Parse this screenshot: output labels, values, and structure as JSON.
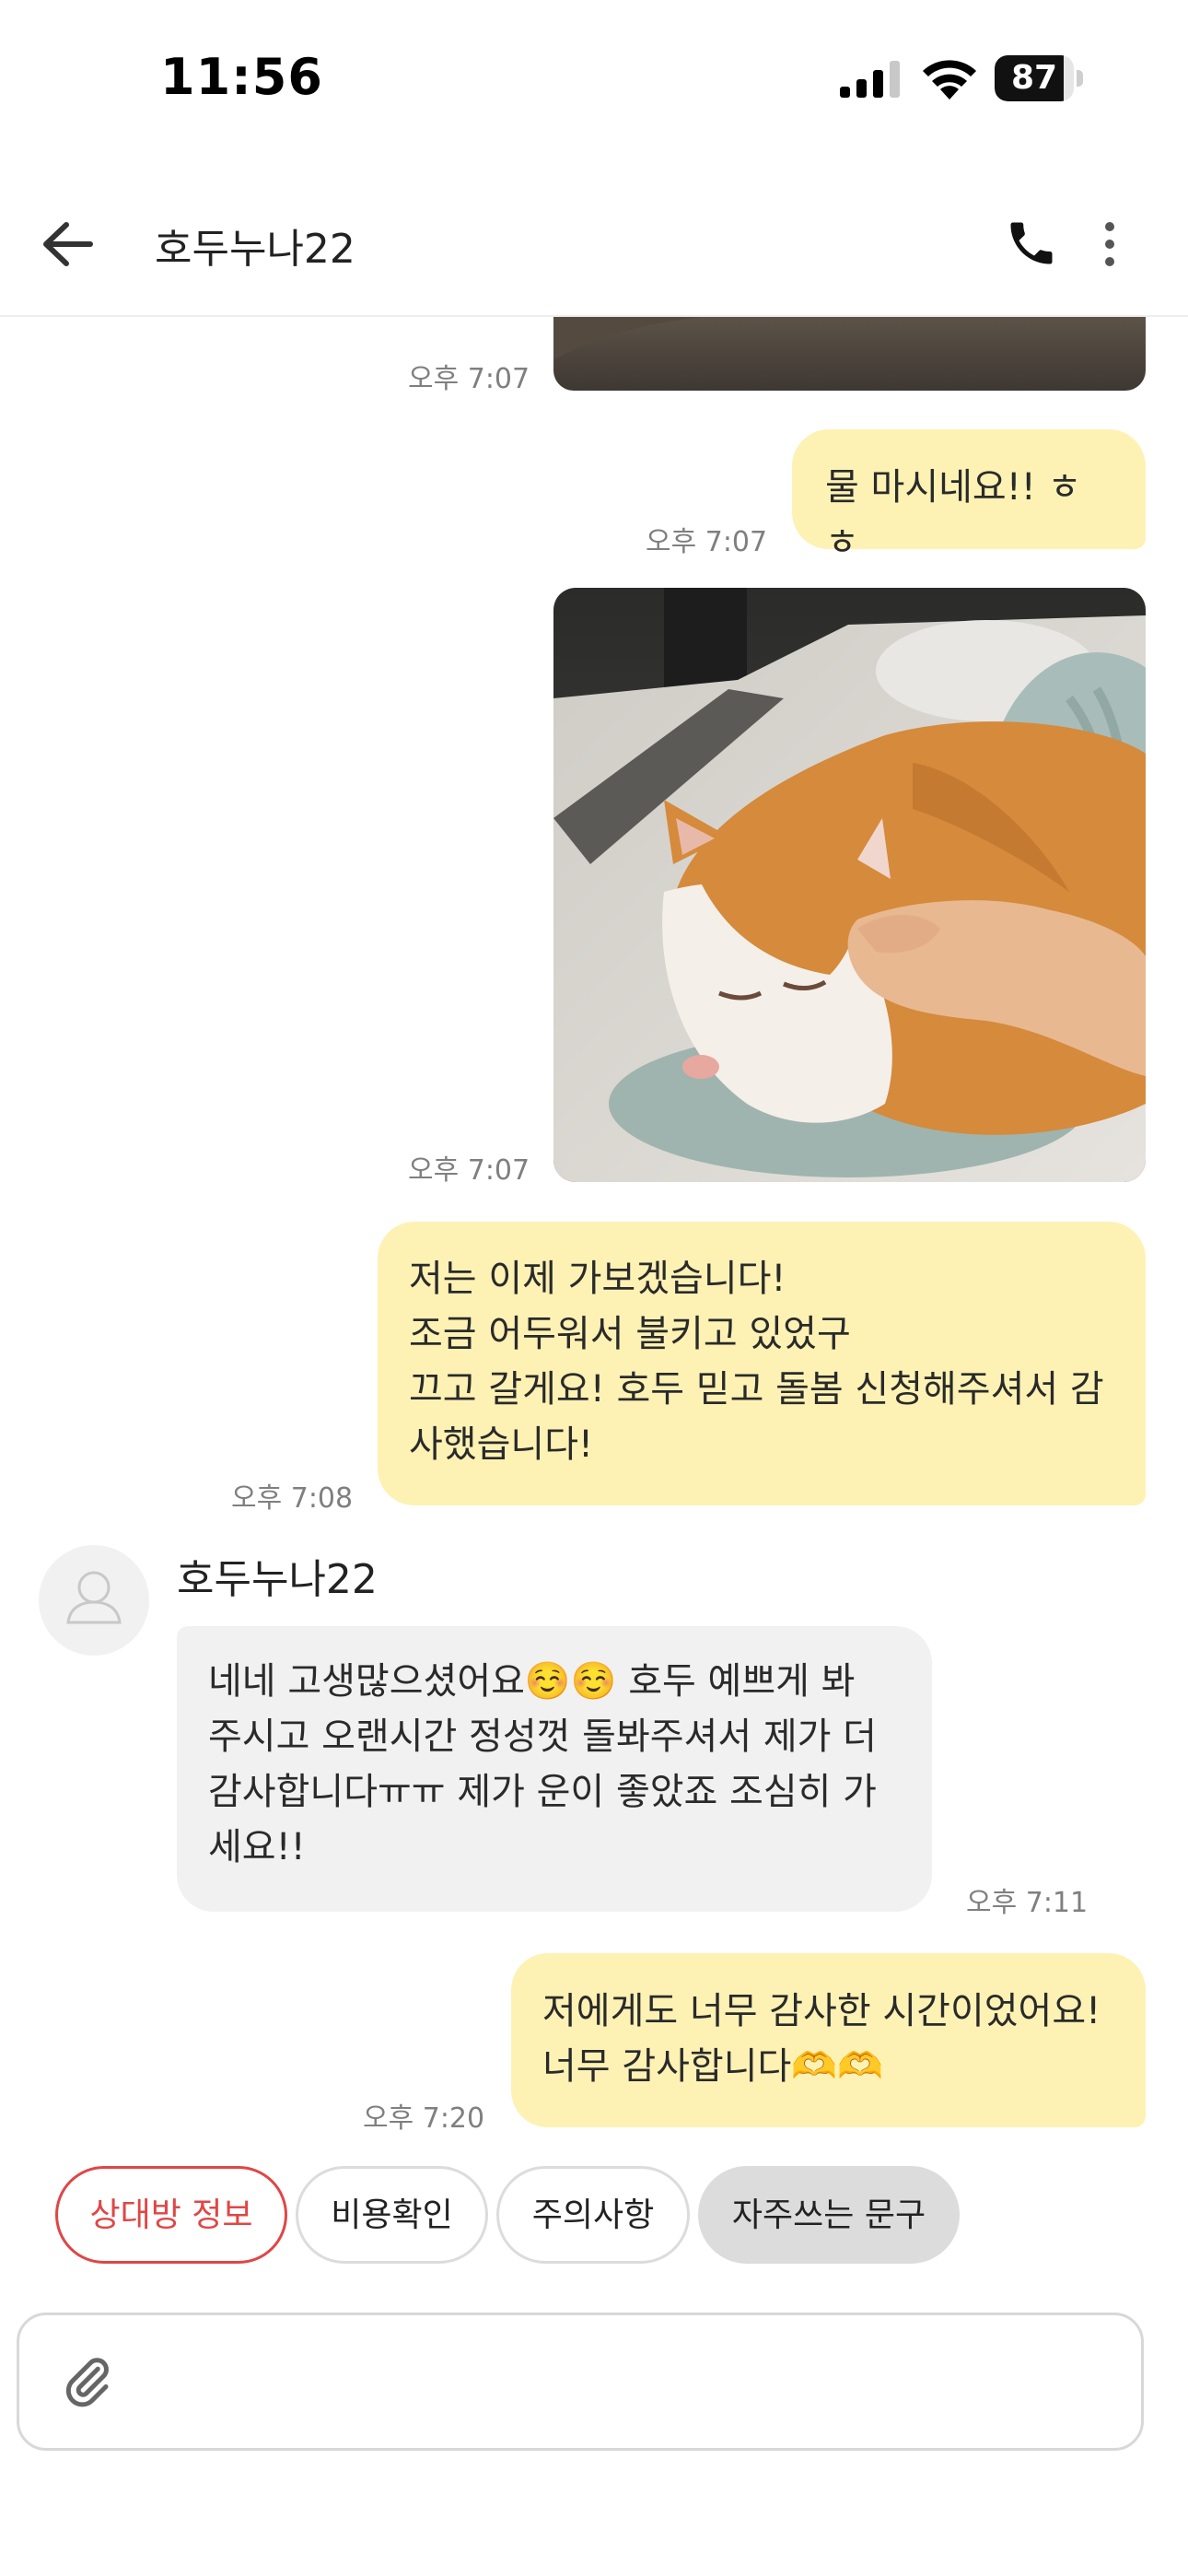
{
  "status_bar": {
    "time": "11:56",
    "battery_level": "87",
    "battery_fraction": 0.87
  },
  "header": {
    "title": "호두누나22",
    "back_icon": "arrow-left-icon",
    "phone_icon": "phone-icon",
    "more_icon": "more-vertical-icon"
  },
  "messages": [
    {
      "type": "image",
      "from": "me",
      "time": "오후 7:07"
    },
    {
      "type": "text",
      "from": "me",
      "text": "물 마시네요!! ㅎㅎ",
      "time": "오후 7:07"
    },
    {
      "type": "image",
      "from": "me",
      "time": "오후 7:07"
    },
    {
      "type": "text",
      "from": "me",
      "text": "저는 이제 가보겠습니다!\n조금 어두워서 불키고 있었구\n끄고 갈게요! 호두 믿고 돌봄 신청해주셔서 감\n사했습니다!",
      "time": "오후 7:08"
    },
    {
      "type": "text",
      "from": "them",
      "sender": "호두누나22",
      "text": "네네 고생많으셨어요☺️☺️ 호두 예쁘게 봐\n주시고 오랜시간 정성껏 돌봐주셔서 제가 더\n감사합니다ㅠㅠ 제가 운이 좋았죠  조심히 가\n세요!!",
      "time": "오후 7:11"
    },
    {
      "type": "text",
      "from": "me",
      "text": "저에게도 너무 감사한 시간이었어요!\n너무 감사합니다🫶🫶",
      "time": "오후 7:20"
    }
  ],
  "quick_actions": [
    "상대방 정보",
    "비용확인",
    "주의사항",
    "자주쓰는 문구"
  ],
  "composer": {
    "placeholder": "",
    "attach_icon": "paperclip-icon"
  },
  "colors": {
    "my_bubble": "#fdf2b4",
    "their_bubble": "#f2f1f1",
    "accent_red": "#e04646",
    "timestamp": "#7f7f7f"
  }
}
